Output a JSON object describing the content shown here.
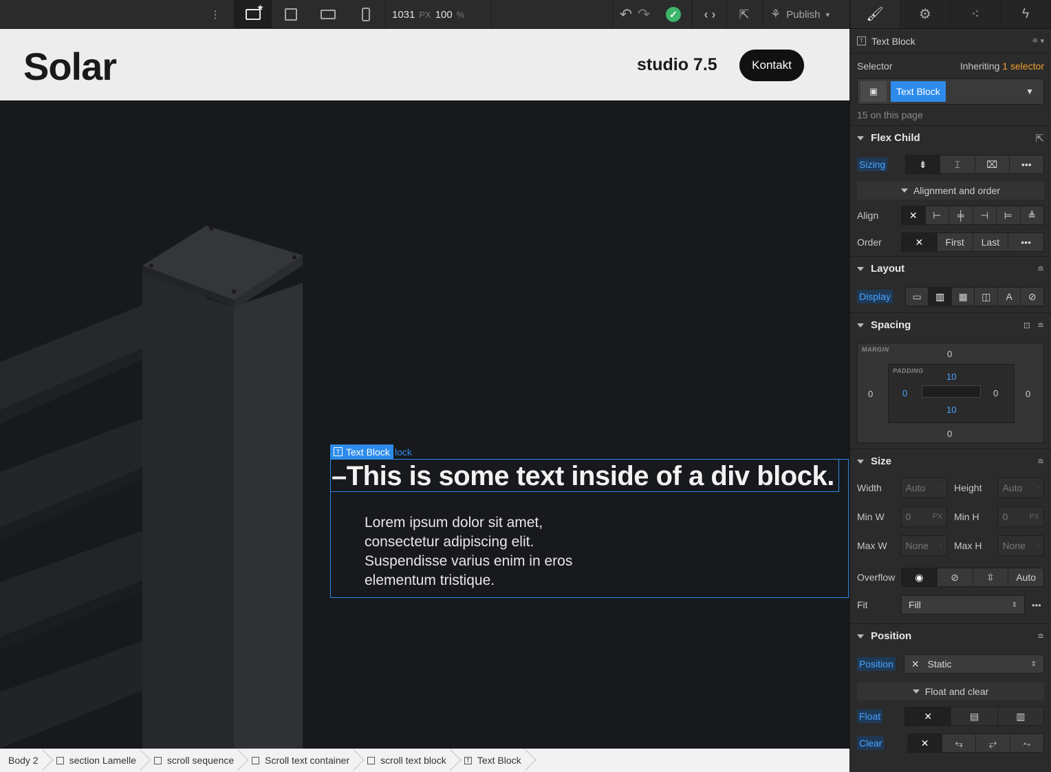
{
  "toolbar": {
    "canvas_width": "1031",
    "width_unit": "PX",
    "zoom": "100",
    "zoom_unit": "%",
    "publish_label": "Publish"
  },
  "site": {
    "logo": "Solar",
    "studio": "studio 7.5",
    "cta": "Kontakt",
    "heading": "This is some text inside of a div block.",
    "body": "Lorem ipsum dolor sit amet, consectetur adipiscing elit. Suspendisse varius enim in eros elementum tristique.",
    "selection_tag": "Text Block",
    "selection_ghost": "lock"
  },
  "breadcrumbs": [
    {
      "label": "Body 2"
    },
    {
      "label": "section Lamelle"
    },
    {
      "label": "scroll sequence"
    },
    {
      "label": "Scroll text container"
    },
    {
      "label": "scroll text block"
    },
    {
      "label": "Text Block"
    }
  ],
  "panel": {
    "element_name": "Text Block",
    "selector_label": "Selector",
    "inheriting": "Inheriting",
    "inheriting_count": "1 selector",
    "selector_chip": "Text Block",
    "on_page": "15 on this page",
    "flex_child": {
      "title": "Flex Child",
      "sizing_label": "Sizing",
      "alignment_sub": "Alignment and order",
      "align_label": "Align",
      "order_label": "Order",
      "order_first": "First",
      "order_last": "Last"
    },
    "layout": {
      "title": "Layout",
      "display_label": "Display"
    },
    "spacing": {
      "title": "Spacing",
      "margin_caption": "MARGIN",
      "padding_caption": "PADDING",
      "margin_top": "0",
      "margin_right": "0",
      "margin_bottom": "0",
      "margin_left": "0",
      "padding_top": "10",
      "padding_right": "0",
      "padding_bottom": "10",
      "padding_left": "0"
    },
    "size": {
      "title": "Size",
      "width_label": "Width",
      "width_val": "Auto",
      "width_unit": "-",
      "height_label": "Height",
      "height_val": "Auto",
      "height_unit": "-",
      "minw_label": "Min W",
      "minw_val": "0",
      "minw_unit": "PX",
      "minh_label": "Min H",
      "minh_val": "0",
      "minh_unit": "PX",
      "maxw_label": "Max W",
      "maxw_val": "None",
      "maxw_unit": "-",
      "maxh_label": "Max H",
      "maxh_val": "None",
      "maxh_unit": "-",
      "overflow_label": "Overflow",
      "overflow_auto": "Auto",
      "fit_label": "Fit",
      "fit_val": "Fill"
    },
    "position": {
      "title": "Position",
      "position_label": "Position",
      "position_val": "Static",
      "float_sub": "Float and clear",
      "float_label": "Float",
      "clear_label": "Clear"
    }
  },
  "colors": {
    "accent": "#2d8ceb",
    "publish_ok": "#3db56a",
    "panel_bg": "#2b2b2b"
  }
}
